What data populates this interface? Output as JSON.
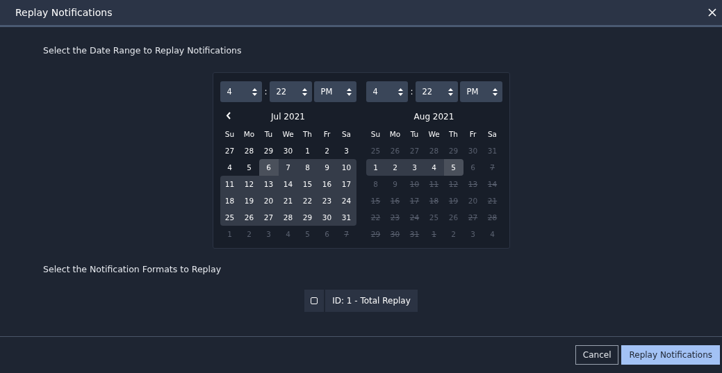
{
  "window": {
    "title": "Replay Notifications"
  },
  "date_section": {
    "heading": "Select the Date Range to Replay Notifications"
  },
  "calendars": [
    {
      "time": {
        "hour": "4",
        "separator": ":",
        "minute": "22",
        "period": "PM"
      },
      "prev_button": true,
      "month": "Jul 2021",
      "weekdays": [
        "Su",
        "Mo",
        "Tu",
        "We",
        "Th",
        "Fr",
        "Sa"
      ],
      "days": [
        {
          "label": "27",
          "in_range": false,
          "range_end": false,
          "dimmed": false,
          "struck": false
        },
        {
          "label": "28",
          "in_range": false,
          "range_end": false,
          "dimmed": false,
          "struck": false
        },
        {
          "label": "29",
          "in_range": false,
          "range_end": false,
          "dimmed": false,
          "struck": false
        },
        {
          "label": "30",
          "in_range": false,
          "range_end": false,
          "dimmed": false,
          "struck": false
        },
        {
          "label": "1",
          "in_range": false,
          "range_end": false,
          "dimmed": false,
          "struck": false
        },
        {
          "label": "2",
          "in_range": false,
          "range_end": false,
          "dimmed": false,
          "struck": false
        },
        {
          "label": "3",
          "in_range": false,
          "range_end": false,
          "dimmed": false,
          "struck": false
        },
        {
          "label": "4",
          "in_range": false,
          "range_end": false,
          "dimmed": false,
          "struck": false
        },
        {
          "label": "5",
          "in_range": false,
          "range_end": false,
          "dimmed": false,
          "struck": false
        },
        {
          "label": "6",
          "in_range": true,
          "range_end": true,
          "dimmed": false,
          "struck": false
        },
        {
          "label": "7",
          "in_range": true,
          "range_end": false,
          "dimmed": false,
          "struck": false
        },
        {
          "label": "8",
          "in_range": true,
          "range_end": false,
          "dimmed": false,
          "struck": false
        },
        {
          "label": "9",
          "in_range": true,
          "range_end": false,
          "dimmed": false,
          "struck": false
        },
        {
          "label": "10",
          "in_range": true,
          "range_end": false,
          "dimmed": false,
          "struck": false
        },
        {
          "label": "11",
          "in_range": true,
          "range_end": false,
          "dimmed": false,
          "struck": false
        },
        {
          "label": "12",
          "in_range": true,
          "range_end": false,
          "dimmed": false,
          "struck": false
        },
        {
          "label": "13",
          "in_range": true,
          "range_end": false,
          "dimmed": false,
          "struck": false
        },
        {
          "label": "14",
          "in_range": true,
          "range_end": false,
          "dimmed": false,
          "struck": false
        },
        {
          "label": "15",
          "in_range": true,
          "range_end": false,
          "dimmed": false,
          "struck": false
        },
        {
          "label": "16",
          "in_range": true,
          "range_end": false,
          "dimmed": false,
          "struck": false
        },
        {
          "label": "17",
          "in_range": true,
          "range_end": false,
          "dimmed": false,
          "struck": false
        },
        {
          "label": "18",
          "in_range": true,
          "range_end": false,
          "dimmed": false,
          "struck": false
        },
        {
          "label": "19",
          "in_range": true,
          "range_end": false,
          "dimmed": false,
          "struck": false
        },
        {
          "label": "20",
          "in_range": true,
          "range_end": false,
          "dimmed": false,
          "struck": false
        },
        {
          "label": "21",
          "in_range": true,
          "range_end": false,
          "dimmed": false,
          "struck": false
        },
        {
          "label": "22",
          "in_range": true,
          "range_end": false,
          "dimmed": false,
          "struck": false
        },
        {
          "label": "23",
          "in_range": true,
          "range_end": false,
          "dimmed": false,
          "struck": false
        },
        {
          "label": "24",
          "in_range": true,
          "range_end": false,
          "dimmed": false,
          "struck": false
        },
        {
          "label": "25",
          "in_range": true,
          "range_end": false,
          "dimmed": false,
          "struck": false
        },
        {
          "label": "26",
          "in_range": true,
          "range_end": false,
          "dimmed": false,
          "struck": false
        },
        {
          "label": "27",
          "in_range": true,
          "range_end": false,
          "dimmed": false,
          "struck": false
        },
        {
          "label": "28",
          "in_range": true,
          "range_end": false,
          "dimmed": false,
          "struck": false
        },
        {
          "label": "29",
          "in_range": true,
          "range_end": false,
          "dimmed": false,
          "struck": false
        },
        {
          "label": "30",
          "in_range": true,
          "range_end": false,
          "dimmed": false,
          "struck": false
        },
        {
          "label": "31",
          "in_range": true,
          "range_end": false,
          "dimmed": false,
          "struck": false
        },
        {
          "label": "1",
          "in_range": false,
          "range_end": false,
          "dimmed": true,
          "struck": false
        },
        {
          "label": "2",
          "in_range": false,
          "range_end": false,
          "dimmed": true,
          "struck": false
        },
        {
          "label": "3",
          "in_range": false,
          "range_end": false,
          "dimmed": true,
          "struck": false
        },
        {
          "label": "4",
          "in_range": false,
          "range_end": false,
          "dimmed": true,
          "struck": false
        },
        {
          "label": "5",
          "in_range": false,
          "range_end": false,
          "dimmed": true,
          "struck": false
        },
        {
          "label": "6",
          "in_range": false,
          "range_end": false,
          "dimmed": true,
          "struck": false
        },
        {
          "label": "7",
          "in_range": false,
          "range_end": false,
          "dimmed": true,
          "struck": true
        }
      ]
    },
    {
      "time": {
        "hour": "4",
        "separator": ":",
        "minute": "22",
        "period": "PM"
      },
      "prev_button": false,
      "month": "Aug 2021",
      "weekdays": [
        "Su",
        "Mo",
        "Tu",
        "We",
        "Th",
        "Fr",
        "Sa"
      ],
      "days": [
        {
          "label": "25",
          "in_range": false,
          "range_end": false,
          "dimmed": true,
          "struck": false
        },
        {
          "label": "26",
          "in_range": false,
          "range_end": false,
          "dimmed": true,
          "struck": false
        },
        {
          "label": "27",
          "in_range": false,
          "range_end": false,
          "dimmed": true,
          "struck": false
        },
        {
          "label": "28",
          "in_range": false,
          "range_end": false,
          "dimmed": true,
          "struck": false
        },
        {
          "label": "29",
          "in_range": false,
          "range_end": false,
          "dimmed": true,
          "struck": false
        },
        {
          "label": "30",
          "in_range": false,
          "range_end": false,
          "dimmed": true,
          "struck": false
        },
        {
          "label": "31",
          "in_range": false,
          "range_end": false,
          "dimmed": true,
          "struck": false
        },
        {
          "label": "1",
          "in_range": true,
          "range_end": false,
          "dimmed": false,
          "struck": false
        },
        {
          "label": "2",
          "in_range": true,
          "range_end": false,
          "dimmed": false,
          "struck": false
        },
        {
          "label": "3",
          "in_range": true,
          "range_end": false,
          "dimmed": false,
          "struck": false
        },
        {
          "label": "4",
          "in_range": true,
          "range_end": false,
          "dimmed": false,
          "struck": false
        },
        {
          "label": "5",
          "in_range": true,
          "range_end": true,
          "dimmed": false,
          "struck": false
        },
        {
          "label": "6",
          "in_range": false,
          "range_end": false,
          "dimmed": true,
          "struck": false
        },
        {
          "label": "7",
          "in_range": false,
          "range_end": false,
          "dimmed": true,
          "struck": true
        },
        {
          "label": "8",
          "in_range": false,
          "range_end": false,
          "dimmed": true,
          "struck": false
        },
        {
          "label": "9",
          "in_range": false,
          "range_end": false,
          "dimmed": true,
          "struck": false
        },
        {
          "label": "10",
          "in_range": false,
          "range_end": false,
          "dimmed": true,
          "struck": true
        },
        {
          "label": "11",
          "in_range": false,
          "range_end": false,
          "dimmed": true,
          "struck": true
        },
        {
          "label": "12",
          "in_range": false,
          "range_end": false,
          "dimmed": true,
          "struck": true
        },
        {
          "label": "13",
          "in_range": false,
          "range_end": false,
          "dimmed": true,
          "struck": true
        },
        {
          "label": "14",
          "in_range": false,
          "range_end": false,
          "dimmed": true,
          "struck": true
        },
        {
          "label": "15",
          "in_range": false,
          "range_end": false,
          "dimmed": true,
          "struck": true
        },
        {
          "label": "16",
          "in_range": false,
          "range_end": false,
          "dimmed": true,
          "struck": true
        },
        {
          "label": "17",
          "in_range": false,
          "range_end": false,
          "dimmed": true,
          "struck": true
        },
        {
          "label": "18",
          "in_range": false,
          "range_end": false,
          "dimmed": true,
          "struck": true
        },
        {
          "label": "19",
          "in_range": false,
          "range_end": false,
          "dimmed": true,
          "struck": true
        },
        {
          "label": "20",
          "in_range": false,
          "range_end": false,
          "dimmed": true,
          "struck": false
        },
        {
          "label": "21",
          "in_range": false,
          "range_end": false,
          "dimmed": true,
          "struck": true
        },
        {
          "label": "22",
          "in_range": false,
          "range_end": false,
          "dimmed": true,
          "struck": true
        },
        {
          "label": "23",
          "in_range": false,
          "range_end": false,
          "dimmed": true,
          "struck": true
        },
        {
          "label": "24",
          "in_range": false,
          "range_end": false,
          "dimmed": true,
          "struck": true
        },
        {
          "label": "25",
          "in_range": false,
          "range_end": false,
          "dimmed": true,
          "struck": false
        },
        {
          "label": "26",
          "in_range": false,
          "range_end": false,
          "dimmed": true,
          "struck": false
        },
        {
          "label": "27",
          "in_range": false,
          "range_end": false,
          "dimmed": true,
          "struck": true
        },
        {
          "label": "28",
          "in_range": false,
          "range_end": false,
          "dimmed": true,
          "struck": true
        },
        {
          "label": "29",
          "in_range": false,
          "range_end": false,
          "dimmed": true,
          "struck": true
        },
        {
          "label": "30",
          "in_range": false,
          "range_end": false,
          "dimmed": true,
          "struck": true
        },
        {
          "label": "31",
          "in_range": false,
          "range_end": false,
          "dimmed": true,
          "struck": true
        },
        {
          "label": "1",
          "in_range": false,
          "range_end": false,
          "dimmed": true,
          "struck": true
        },
        {
          "label": "2",
          "in_range": false,
          "range_end": false,
          "dimmed": true,
          "struck": false
        },
        {
          "label": "3",
          "in_range": false,
          "range_end": false,
          "dimmed": true,
          "struck": false
        },
        {
          "label": "4",
          "in_range": false,
          "range_end": false,
          "dimmed": true,
          "struck": false
        }
      ]
    }
  ],
  "format_section": {
    "heading": "Select the Notification Formats to Replay",
    "formats": [
      {
        "label": "ID: 1 - Total Replay",
        "checked": false
      }
    ]
  },
  "buttons": [
    {
      "label": "Cancel",
      "kind": "secondary"
    },
    {
      "label": "Replay Notifications",
      "kind": "primary"
    }
  ]
}
